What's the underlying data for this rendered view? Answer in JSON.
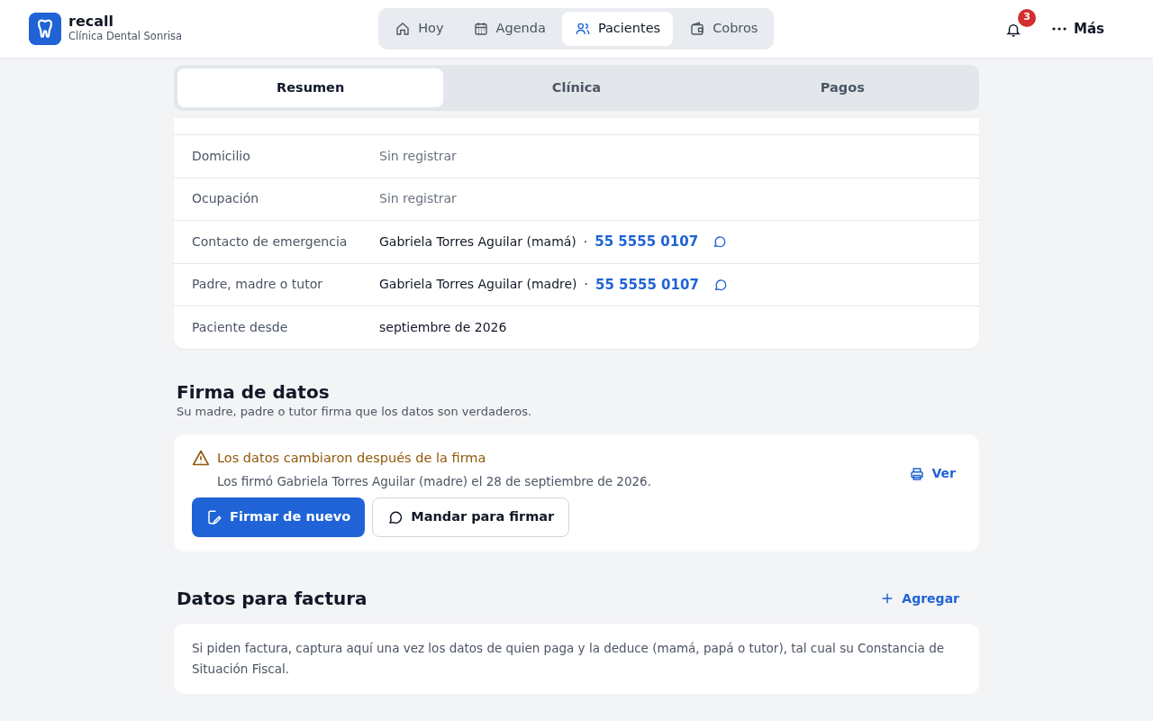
{
  "brand": {
    "name": "recall",
    "clinic": "Clínica Dental Sonrisa"
  },
  "nav": [
    {
      "label": "Hoy",
      "selected": false
    },
    {
      "label": "Agenda",
      "selected": false
    },
    {
      "label": "Pacientes",
      "selected": true
    },
    {
      "label": "Cobros",
      "selected": false
    }
  ],
  "notifications": {
    "count": "3"
  },
  "more": {
    "label": "Más"
  },
  "tabs": [
    {
      "label": "Resumen",
      "selected": true
    },
    {
      "label": "Clínica",
      "selected": false
    },
    {
      "label": "Pagos",
      "selected": false
    }
  ],
  "details": [
    {
      "label": "Domicilio",
      "value": "Sin registrar",
      "empty": true
    },
    {
      "label": "Ocupación",
      "value": "Sin registrar",
      "empty": true
    },
    {
      "label": "Contacto de emergencia",
      "value": "Gabriela Torres Aguilar (mamá)",
      "separator": "·",
      "phone": "55 5555 0107",
      "empty": false
    },
    {
      "label": "Padre, madre o tutor",
      "value": "Gabriela Torres Aguilar (madre)",
      "separator": "·",
      "phone": "55 5555 0107",
      "empty": false
    },
    {
      "label": "Paciente desde",
      "value": "septiembre de 2026",
      "empty": false
    }
  ],
  "signature": {
    "title": "Firma de datos",
    "subtitle": "Su madre, padre o tutor firma que los datos son verdaderos.",
    "warning": "Los datos cambiaron después de la firma",
    "detail": "Los firmó Gabriela Torres Aguilar (madre) el 28 de septiembre de 2026.",
    "view": "Ver",
    "primary": "Firmar de nuevo",
    "secondary": "Mandar para firmar"
  },
  "billing": {
    "title": "Datos para factura",
    "add": "Agregar",
    "note": "Si piden factura, captura aquí una vez los datos de quien paga y la deduce (mamá, papá o tutor), tal cual su Constancia de Situación Fiscal."
  }
}
